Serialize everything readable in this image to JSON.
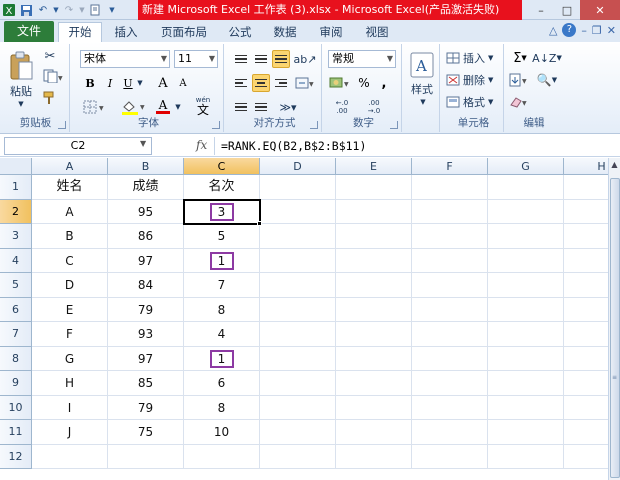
{
  "window": {
    "title": "新建 Microsoft Excel 工作表 (3).xlsx - Microsoft Excel(产品激活失败)",
    "minimize": "–",
    "maximize": "□",
    "close": "✕"
  },
  "ribbon_tabs": {
    "file": "文件",
    "tabs": [
      "开始",
      "插入",
      "页面布局",
      "公式",
      "数据",
      "审阅",
      "视图"
    ],
    "active": "开始"
  },
  "clipboard": {
    "paste": "粘贴",
    "label": "剪贴板"
  },
  "font": {
    "name": "宋体",
    "size": "11",
    "bold": "B",
    "italic": "I",
    "underline": "U",
    "grow": "A",
    "shrink": "A",
    "font_color": "A",
    "wen": "wén",
    "label": "字体"
  },
  "alignment": {
    "label": "对齐方式"
  },
  "number": {
    "format": "常规",
    "percent": "%",
    "comma": ",",
    "inc_dec": ".00",
    "label": "数字"
  },
  "styles": {
    "button": "样式"
  },
  "cells": {
    "insert": "插入",
    "delete": "删除",
    "format": "格式",
    "label": "单元格"
  },
  "editing": {
    "label": "编辑"
  },
  "formula_bar": {
    "name_box": "C2",
    "fx": "fx",
    "formula": "=RANK.EQ(B2,B$2:B$11)"
  },
  "sheet": {
    "columns": [
      "A",
      "B",
      "C",
      "D",
      "E",
      "F",
      "G",
      "H"
    ],
    "rows": [
      {
        "num": "1",
        "a": "姓名",
        "b": "成绩",
        "c": "名次"
      },
      {
        "num": "2",
        "a": "A",
        "b": "95",
        "c": "3"
      },
      {
        "num": "3",
        "a": "B",
        "b": "86",
        "c": "5"
      },
      {
        "num": "4",
        "a": "C",
        "b": "97",
        "c": "1"
      },
      {
        "num": "5",
        "a": "D",
        "b": "84",
        "c": "7"
      },
      {
        "num": "6",
        "a": "E",
        "b": "79",
        "c": "8"
      },
      {
        "num": "7",
        "a": "F",
        "b": "93",
        "c": "4"
      },
      {
        "num": "8",
        "a": "G",
        "b": "97",
        "c": "1"
      },
      {
        "num": "9",
        "a": "H",
        "b": "85",
        "c": "6"
      },
      {
        "num": "10",
        "a": "I",
        "b": "79",
        "c": "8"
      },
      {
        "num": "11",
        "a": "J",
        "b": "75",
        "c": "10"
      },
      {
        "num": "12",
        "a": "",
        "b": "",
        "c": ""
      }
    ],
    "active_cell": "C2",
    "highlight_color": "#8d3aa3",
    "header_highlight": "#f1c15f"
  }
}
